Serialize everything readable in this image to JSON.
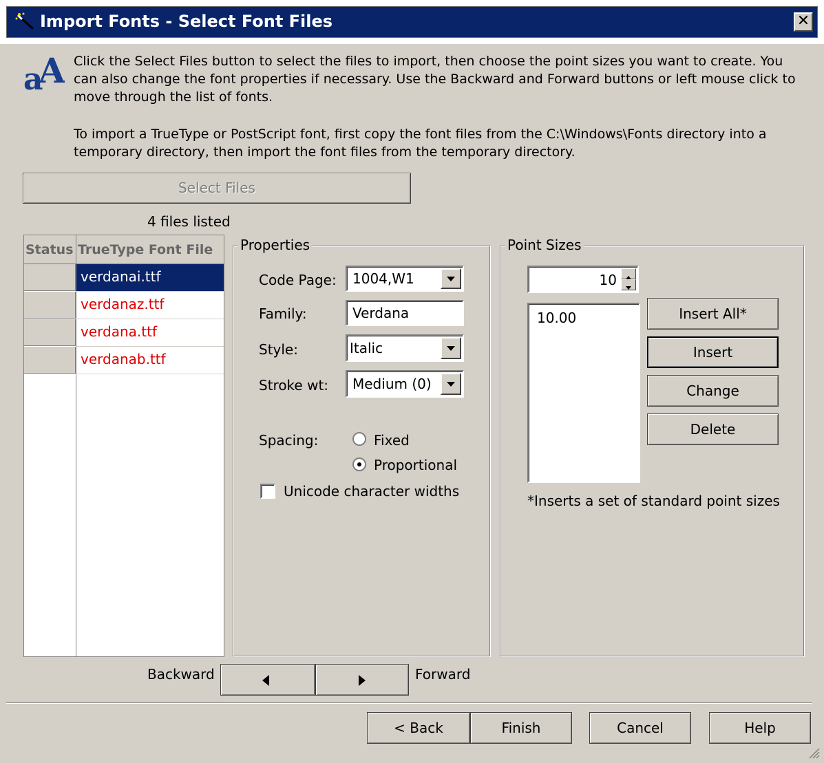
{
  "window": {
    "title": "Import Fonts - Select Font Files",
    "close_glyph": "✕"
  },
  "intro": {
    "paragraph1": "Click the Select Files button to select the files to import, then choose the point sizes you want to create. You can also change the font properties if necessary. Use the Backward and Forward buttons or left mouse click to move through the list of fonts.",
    "paragraph2": "To import a TrueType or PostScript font, first copy the font files from the C:\\Windows\\Fonts directory into a temporary directory, then import the font files from the temporary directory.",
    "icon": "font-aa-icon"
  },
  "select_files": {
    "label": "Select Files",
    "count_text": "4 files listed"
  },
  "file_table": {
    "headers": [
      "Status",
      "TrueType Font File"
    ],
    "rows": [
      {
        "status": "",
        "name": "verdanai.ttf",
        "selected": true
      },
      {
        "status": "",
        "name": "verdanaz.ttf",
        "selected": false
      },
      {
        "status": "",
        "name": "verdana.ttf",
        "selected": false
      },
      {
        "status": "",
        "name": "verdanab.ttf",
        "selected": false
      }
    ]
  },
  "properties": {
    "group_label": "Properties",
    "code_page_label": "Code Page:",
    "code_page_value": "1004,W1",
    "family_label": "Family:",
    "family_value": "Verdana",
    "style_label": "Style:",
    "style_value": "Italic",
    "stroke_label": "Stroke wt:",
    "stroke_value": "Medium (0)",
    "spacing_label": "Spacing:",
    "spacing_fixed": "Fixed",
    "spacing_proportional": "Proportional",
    "spacing_selected": "Proportional",
    "unicode_label": "Unicode character widths",
    "unicode_checked": false
  },
  "point_sizes": {
    "group_label": "Point Sizes",
    "spinner_value": "10",
    "list": [
      "10.00"
    ],
    "insert_all_label": "Insert All*",
    "insert_label": "Insert",
    "change_label": "Change",
    "delete_label": "Delete",
    "note": "*Inserts a set of standard point sizes"
  },
  "navigation": {
    "backward_label": "Backward",
    "forward_label": "Forward"
  },
  "footer": {
    "back_label": "< Back",
    "finish_label": "Finish",
    "cancel_label": "Cancel",
    "help_label": "Help"
  },
  "colors": {
    "title_bar": "#0a246a",
    "dialog": "#d4d0c8",
    "unselected_file": "#e00000",
    "selection": "#0a246a"
  }
}
